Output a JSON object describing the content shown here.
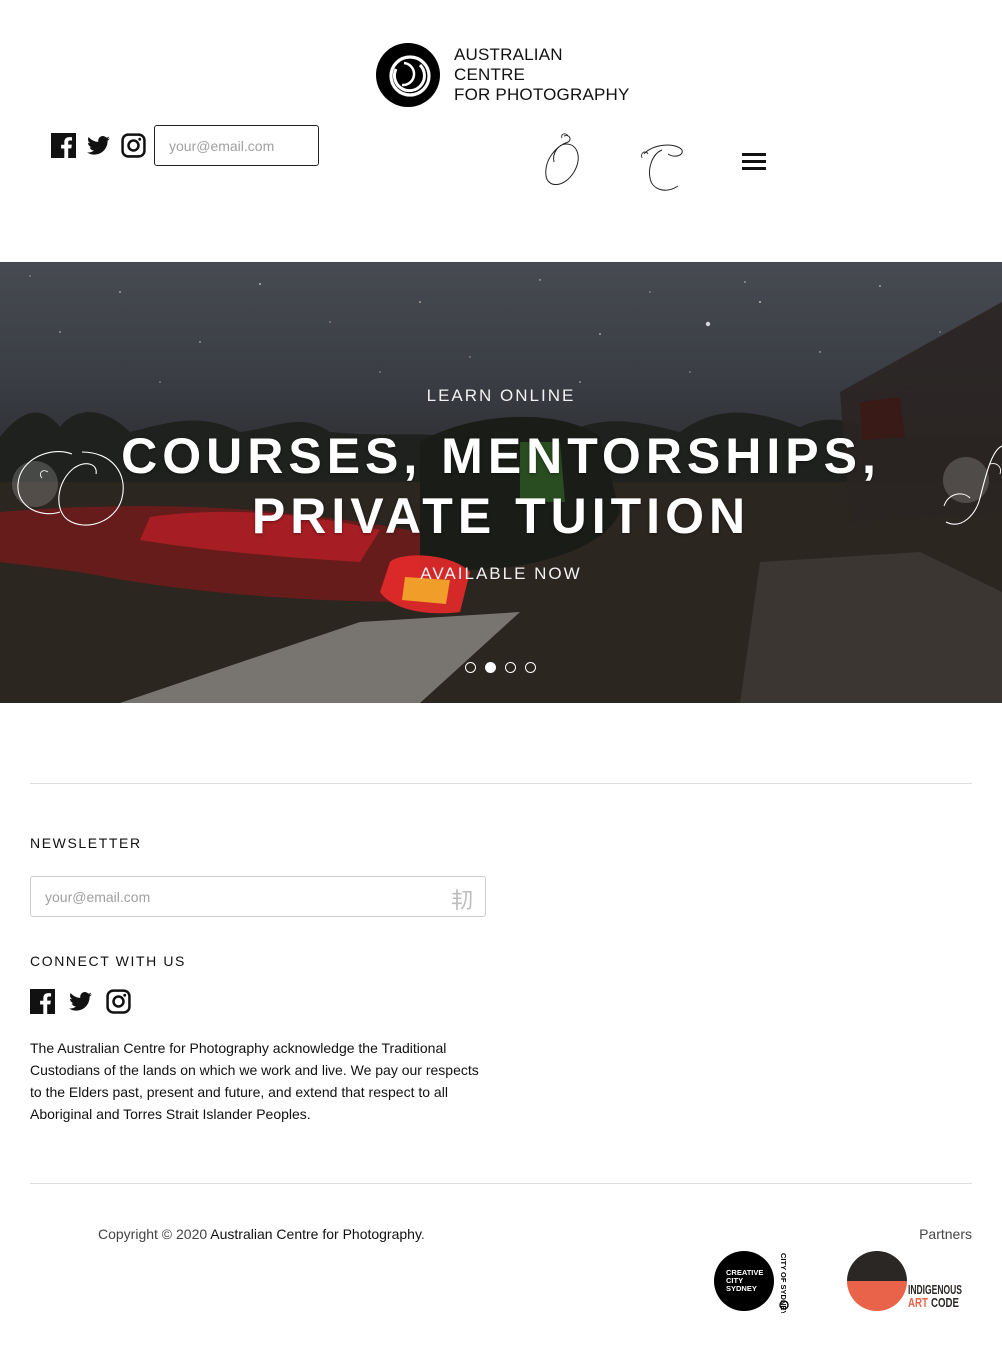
{
  "header": {
    "logo": {
      "icon": "acp-circle-logo-icon",
      "line1": "AUSTRALIAN",
      "line2": "CENTRE",
      "line3": "FOR PHOTOGRAPHY"
    },
    "social": [
      "facebook-icon",
      "twitter-icon",
      "instagram-icon"
    ],
    "email_placeholder": "your@email.com",
    "decorative": [
      "script-o-flourish",
      "script-c-flourish"
    ],
    "menu_icon": "hamburger-menu-icon"
  },
  "hero": {
    "kicker": "LEARN ONLINE",
    "title_line1": "COURSES, MENTORSHIPS,",
    "title_line2": "PRIVATE TUITION",
    "subtitle": "AVAILABLE NOW",
    "slides_total": 4,
    "active_slide": 2,
    "prev_icon": "script-flourish-prev-arrow",
    "next_icon": "script-flourish-next-arrow"
  },
  "footer": {
    "newsletter_heading": "NEWSLETTER",
    "newsletter_placeholder": "your@email.com",
    "newsletter_submit_glyph": "㓞",
    "connect_heading": "CONNECT WITH US",
    "social": [
      "facebook-icon",
      "twitter-icon",
      "instagram-icon"
    ],
    "acknowledgement": "The Australian Centre for Photography acknowledge the Traditional Custodians of the lands on which we work and live. We pay our respects to the Elders past, present and future, and extend that respect to all Aboriginal and Torres Strait Islander Peoples.",
    "copyright_prefix": "Copyright © 2020 ",
    "copyright_link": "Australian Centre for Photography",
    "copyright_suffix": ".",
    "partners_label": "Partners",
    "partner_1": {
      "line1": "CREATIVE",
      "line2": "CITY",
      "line3": "SYDNEY",
      "side": "CITY OF SYDNEY"
    },
    "partner_2": {
      "line1": "INDIGENOUS",
      "line2a": "ART",
      "line2b": "CODE"
    }
  },
  "colors": {
    "text": "#111111",
    "border": "#cccccc",
    "iac_orange": "#e8634a",
    "iac_dark": "#2b2724",
    "ccs_black": "#000000"
  }
}
